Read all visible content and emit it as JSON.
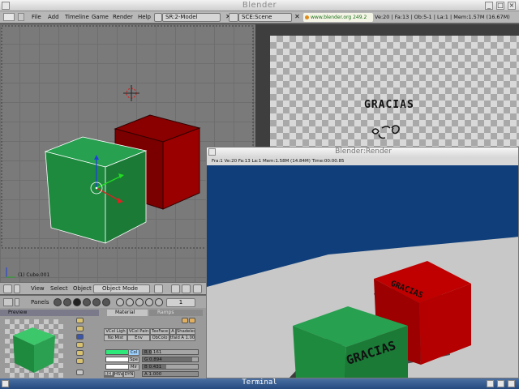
{
  "window": {
    "title": "Blender"
  },
  "header": {
    "menus": [
      "File",
      "Add",
      "Timeline",
      "Game",
      "Render",
      "Help"
    ],
    "screen": "SR:2-Model",
    "scene": "SCE:Scene",
    "site": "www.blender.org 249.2",
    "stats": "Ve:20 | Fa:13 | Ob:5-1 | La:1  | Mem:1.57M (16.67M)"
  },
  "viewport": {
    "object_name": "(1) Cube.001"
  },
  "view_header": {
    "menus": [
      "View",
      "Select",
      "Object"
    ],
    "mode": "Object Mode"
  },
  "image_area": {
    "text": "GRACIAS"
  },
  "buttons": {
    "panels_label": "Panels",
    "page": "1",
    "tabs": {
      "preview": "Preview",
      "material": "Material",
      "ramps": "Ramps"
    },
    "row1": [
      "VCol Ligh",
      "VCol Pain",
      "TexFace",
      "A",
      "Shadeles"
    ],
    "row2": [
      "No Mist",
      "Env",
      "ObColo",
      "tfaid A 1.00"
    ],
    "colors": [
      {
        "label": "Col",
        "value": "R 0.161",
        "fill": 0.161,
        "swatch": "#2ee87a"
      },
      {
        "label": "Spe",
        "value": "G 0.894",
        "fill": 0.894,
        "swatch": "#ffffff"
      },
      {
        "label": "Mir",
        "value": "B 0.431",
        "fill": 0.431,
        "swatch": "#ffffff"
      }
    ],
    "mode_row": [
      "RGB",
      "HSV",
      "DYN",
      "A 1.000"
    ]
  },
  "render_window": {
    "title": "Blender:Render",
    "status": "Fra:1  Ve:20 Fa:13 La:1  Mem:1.58M (14.84M)  Time:00:00.85",
    "cube_text": "GRACIAS"
  },
  "terminal": {
    "title": "Terminal"
  },
  "colors": {
    "cube_green": "#1e8a3e",
    "cube_red": "#a80000",
    "render_bg": "#0f3e7a"
  }
}
